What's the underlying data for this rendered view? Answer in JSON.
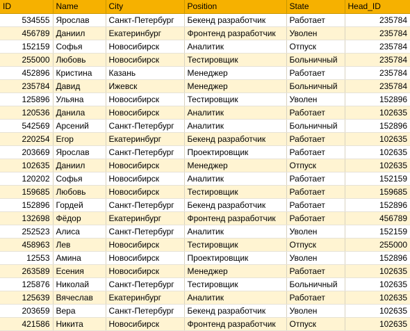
{
  "table": {
    "columns": [
      "ID",
      "Name",
      "City",
      "Position",
      "State",
      "Head_ID"
    ],
    "rows": [
      [
        "534555",
        "Ярослав",
        "Санкт-Петербург",
        "Бекенд разработчик",
        "Работает",
        "235784"
      ],
      [
        "456789",
        "Даниил",
        "Екатеринбург",
        "Фронтенд разработчик",
        "Уволен",
        "235784"
      ],
      [
        "152159",
        "Софья",
        "Новосибирск",
        "Аналитик",
        "Отпуск",
        "235784"
      ],
      [
        "255000",
        "Любовь",
        "Новосибирск",
        "Тестировщик",
        "Больничный",
        "235784"
      ],
      [
        "452896",
        "Кристина",
        "Казань",
        "Менеджер",
        "Работает",
        "235784"
      ],
      [
        "235784",
        "Давид",
        "Ижевск",
        "Менеджер",
        "Больничный",
        "235784"
      ],
      [
        "125896",
        "Ульяна",
        "Новосибирск",
        "Тестировщик",
        "Уволен",
        "152896"
      ],
      [
        "120536",
        "Данила",
        "Новосибирск",
        "Аналитик",
        "Работает",
        "102635"
      ],
      [
        "542569",
        "Арсений",
        "Санкт-Петербург",
        "Аналитик",
        "Больничный",
        "152896"
      ],
      [
        "220254",
        "Егор",
        "Екатеринбург",
        "Бекенд разработчик",
        "Работает",
        "102635"
      ],
      [
        "203669",
        "Ярослав",
        "Санкт-Петербург",
        "Проектировщик",
        "Работает",
        "102635"
      ],
      [
        "102635",
        "Даниил",
        "Новосибирск",
        "Менеджер",
        "Отпуск",
        "102635"
      ],
      [
        "120202",
        "Софья",
        "Новосибирск",
        "Аналитик",
        "Работает",
        "152159"
      ],
      [
        "159685",
        "Любовь",
        "Новосибирск",
        "Тестировщик",
        "Работает",
        "159685"
      ],
      [
        "152896",
        "Гордей",
        "Санкт-Петербург",
        "Бекенд разработчик",
        "Работает",
        "152896"
      ],
      [
        "132698",
        "Фёдор",
        "Екатеринбург",
        "Фронтенд разработчик",
        "Работает",
        "456789"
      ],
      [
        "252523",
        "Алиса",
        "Санкт-Петербург",
        "Аналитик",
        "Уволен",
        "152159"
      ],
      [
        "458963",
        "Лев",
        "Новосибирск",
        "Тестировщик",
        "Отпуск",
        "255000"
      ],
      [
        "12553",
        "Амина",
        "Новосибирск",
        "Проектировщик",
        "Уволен",
        "152896"
      ],
      [
        "263589",
        "Есения",
        "Новосибирск",
        "Менеджер",
        "Работает",
        "102635"
      ],
      [
        "125876",
        "Николай",
        "Санкт-Петербург",
        "Тестировщик",
        "Больничный",
        "102635"
      ],
      [
        "125639",
        "Вячеслав",
        "Екатеринбург",
        "Аналитик",
        "Работает",
        "102635"
      ],
      [
        "203659",
        "Вера",
        "Санкт-Петербург",
        "Бекенд разработчик",
        "Уволен",
        "102635"
      ],
      [
        "421586",
        "Никита",
        "Новосибирск",
        "Фронтенд разработчик",
        "Отпуск",
        "102635"
      ]
    ]
  },
  "colors": {
    "header_bg": "#f6b100",
    "row_alt_bg": "#fff4d2",
    "row_bg": "#ffffff"
  }
}
